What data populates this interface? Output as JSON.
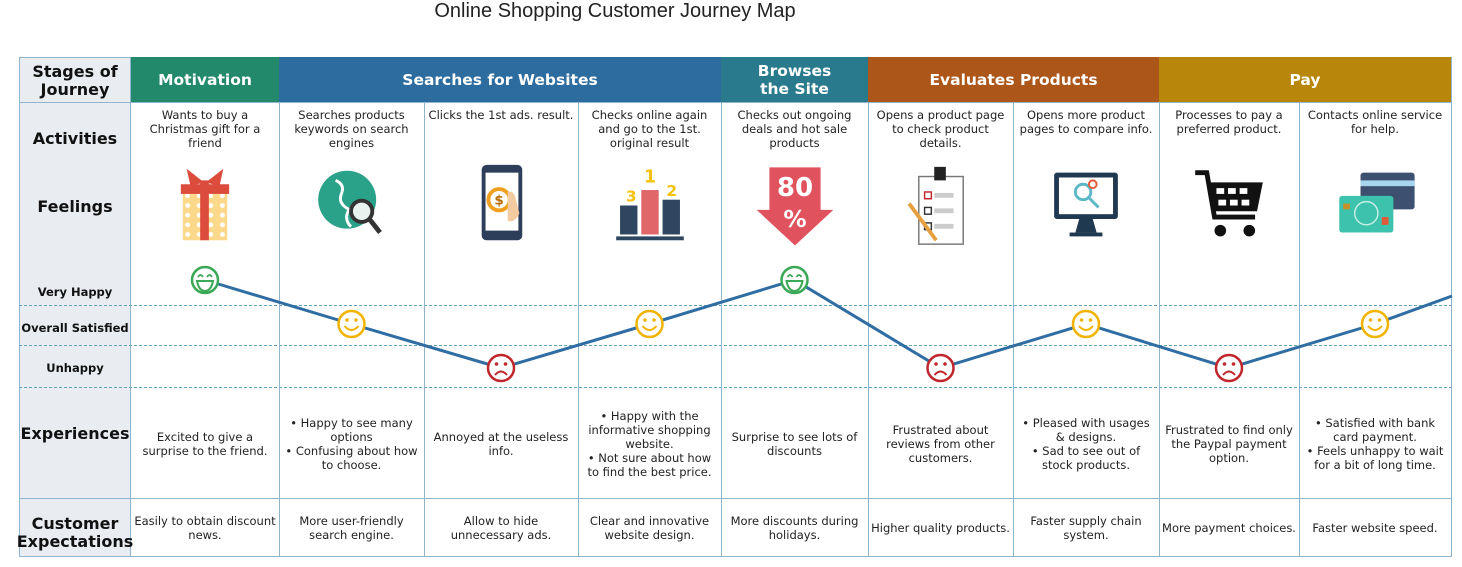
{
  "title": "Online Shopping Customer Journey Map",
  "row_labels": {
    "stages": "Stages of Journey",
    "activities": "Activities",
    "feelings": "Feelings",
    "very_happy": "Very Happy",
    "overall_satisfied": "Overall Satisfied",
    "unhappy": "Unhappy",
    "experiences": "Experiences",
    "expectations": "Customer Expectations"
  },
  "stages": [
    {
      "label": "Motivation",
      "color": "#22896a"
    },
    {
      "label": "Searches for Websites",
      "color": "#2d6c9f"
    },
    {
      "label": "Browses the Site",
      "color": "#2a7a8e"
    },
    {
      "label": "Evaluates Products",
      "color": "#ad5619"
    },
    {
      "label": "Pay",
      "color": "#b7860b"
    }
  ],
  "columns": [
    {
      "activity": "Wants to buy a Christmas gift for a friend",
      "icon": "gift-icon",
      "feeling": "Very Happy",
      "experience": "Excited to give a surprise to the friend.",
      "expectation": "Easily to obtain discount news."
    },
    {
      "activity": "Searches products keywords on search engines",
      "icon": "globe-search-icon",
      "feeling": "Overall Satisfied",
      "experience": "• Happy to see many options\n• Confusing about how to choose.",
      "expectation": "More user-friendly search engine."
    },
    {
      "activity": "Clicks the 1st ads. result.",
      "icon": "phone-dollar-icon",
      "feeling": "Unhappy",
      "experience": "Annoyed at the useless info.",
      "expectation": "Allow to hide unnecessary ads."
    },
    {
      "activity": "Checks online again and go to the 1st. original result",
      "icon": "podium-icon",
      "feeling": "Overall Satisfied",
      "experience": "• Happy with the informative shopping website.\n• Not sure about how to find the best price.",
      "expectation": "Clear and innovative website design."
    },
    {
      "activity": "Checks out ongoing deals and hot sale products",
      "icon": "discount-arrow-icon",
      "icon_text": "80 %",
      "feeling": "Very Happy",
      "experience": "Surprise to see lots of discounts",
      "expectation": "More discounts during holidays."
    },
    {
      "activity": "Opens a product page to check product details.",
      "icon": "checklist-icon",
      "feeling": "Unhappy",
      "experience": "Frustrated about reviews from other customers.",
      "expectation": "Higher quality products."
    },
    {
      "activity": "Opens more product pages to compare info.",
      "icon": "monitor-search-icon",
      "feeling": "Overall Satisfied",
      "experience": "• Pleased with usages & designs.\n• Sad to see out of stock products.",
      "expectation": "Faster supply chain system."
    },
    {
      "activity": "Processes to pay a preferred product.",
      "icon": "shopping-cart-icon",
      "feeling": "Unhappy",
      "experience": "Frustrated to find only the Paypal payment option.",
      "expectation": "More payment choices."
    },
    {
      "activity": "Contacts online service for help.",
      "icon": "bank-cards-icon",
      "feeling": "Overall Satisfied",
      "experience": "• Satisfied with bank card payment.\n• Feels unhappy to wait for a bit of long time.",
      "expectation": "Faster website speed."
    }
  ],
  "colors": {
    "line": "#2f6da3",
    "happy": "#3aa856",
    "satisfied": "#f0b400",
    "unhappy": "#c0272d",
    "grid": "#8fb4cf"
  }
}
